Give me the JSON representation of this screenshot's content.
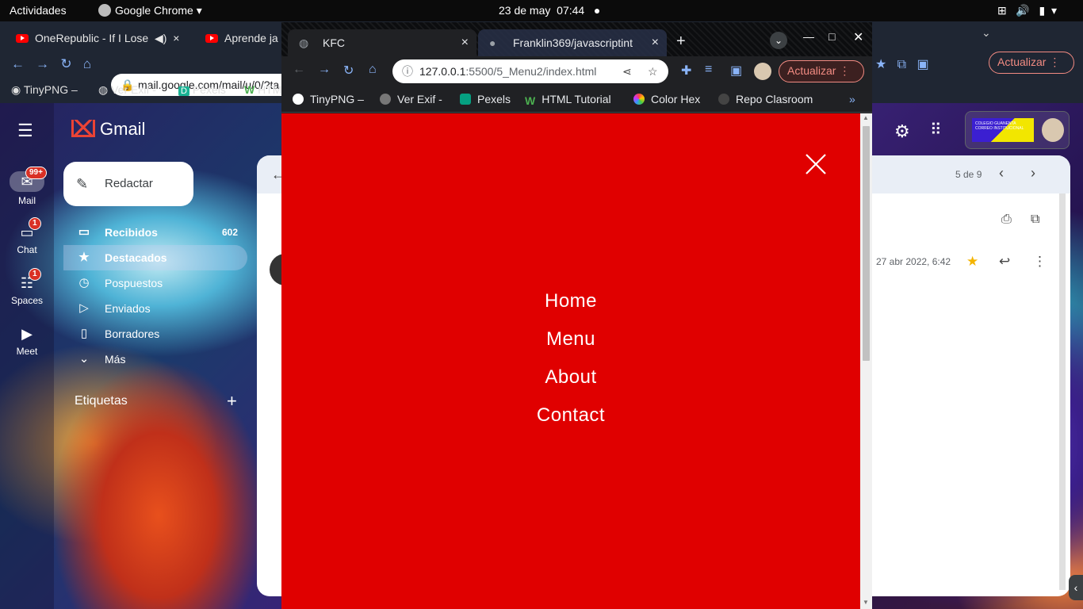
{
  "topbar": {
    "activities": "Actividades",
    "app": "Google Chrome",
    "date": "23 de may",
    "time": "07:44"
  },
  "bg_browser": {
    "tabs": [
      {
        "label": "OneRepublic - If I Lose"
      },
      {
        "label": "Aprende ja"
      }
    ],
    "url": "mail.google.com/mail/u/0/?ta",
    "bookmarks": [
      "TinyPNG –",
      "Ver Exif -",
      "Pexels",
      "HTM"
    ],
    "update_label": "Actualizar"
  },
  "gmail": {
    "logo": "Gmail",
    "rail": [
      {
        "label": "Mail",
        "badge": "99+"
      },
      {
        "label": "Chat",
        "badge": "1"
      },
      {
        "label": "Spaces",
        "badge": "1"
      },
      {
        "label": "Meet"
      }
    ],
    "compose": "Redactar",
    "nav": [
      {
        "label": "Recibidos",
        "count": "602"
      },
      {
        "label": "Destacados"
      },
      {
        "label": "Pospuestos"
      },
      {
        "label": "Enviados"
      },
      {
        "label": "Borradores"
      },
      {
        "label": "Más"
      }
    ],
    "labels_heading": "Etiquetas",
    "pagination": "5 de 9",
    "message_date": "27 abr 2022, 6:42",
    "account_badge": "COLEGIO GUANENTA CORREO INSTITUCIONAL"
  },
  "front_browser": {
    "tabs": [
      {
        "label": "KFC",
        "active": true
      },
      {
        "label": "Franklin369/javascriptint"
      }
    ],
    "url_host": "127.0.0.1",
    "url_path": ":5500/5_Menu2/index.html",
    "update_label": "Actualizar",
    "bookmarks": [
      "TinyPNG –",
      "Ver Exif -",
      "Pexels",
      "HTML Tutorial",
      "Color Hex",
      "Repo Clasroom"
    ],
    "more": "»"
  },
  "page": {
    "background": "#e00000",
    "menu": [
      "Home",
      "Menu",
      "About",
      "Contact"
    ]
  }
}
